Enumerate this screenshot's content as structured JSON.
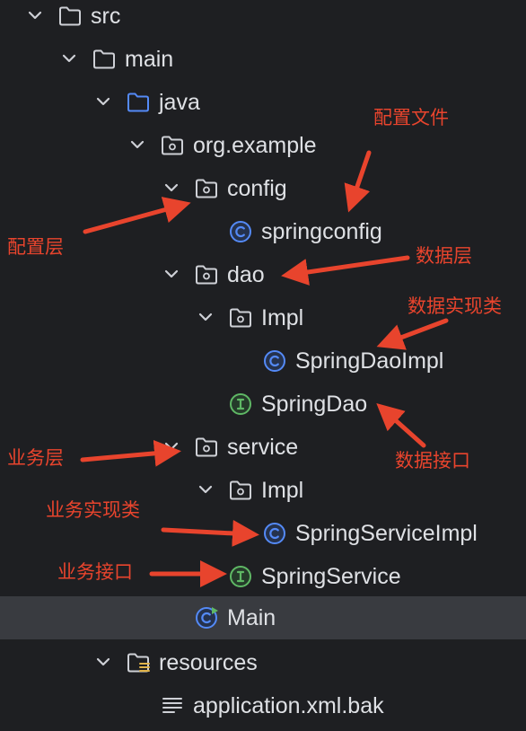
{
  "tree": {
    "nodes": [
      {
        "label": "src"
      },
      {
        "label": "main"
      },
      {
        "label": "java"
      },
      {
        "label": "org.example"
      },
      {
        "label": "config"
      },
      {
        "label": "springconfig"
      },
      {
        "label": "dao"
      },
      {
        "label": "Impl"
      },
      {
        "label": "SpringDaoImpl"
      },
      {
        "label": "SpringDao"
      },
      {
        "label": "service"
      },
      {
        "label": "Impl"
      },
      {
        "label": "SpringServiceImpl"
      },
      {
        "label": "SpringService"
      },
      {
        "label": "Main"
      },
      {
        "label": "resources"
      },
      {
        "label": "application.xml.bak"
      }
    ]
  },
  "annotations": {
    "config_file": "配置文件",
    "config_layer": "配置层",
    "data_layer": "数据层",
    "data_impl": "数据实现类",
    "data_interface": "数据接口",
    "service_layer": "业务层",
    "service_impl": "业务实现类",
    "service_interface": "业务接口"
  },
  "colors": {
    "background": "#1e1f22",
    "selected_row": "#393b40",
    "text": "#dfe1e5",
    "folder_icon": "#ced0d6",
    "source_folder_icon": "#548af7",
    "class_icon": "#548af7",
    "interface_icon": "#5fb865",
    "annotation_red": "#e8442d"
  }
}
